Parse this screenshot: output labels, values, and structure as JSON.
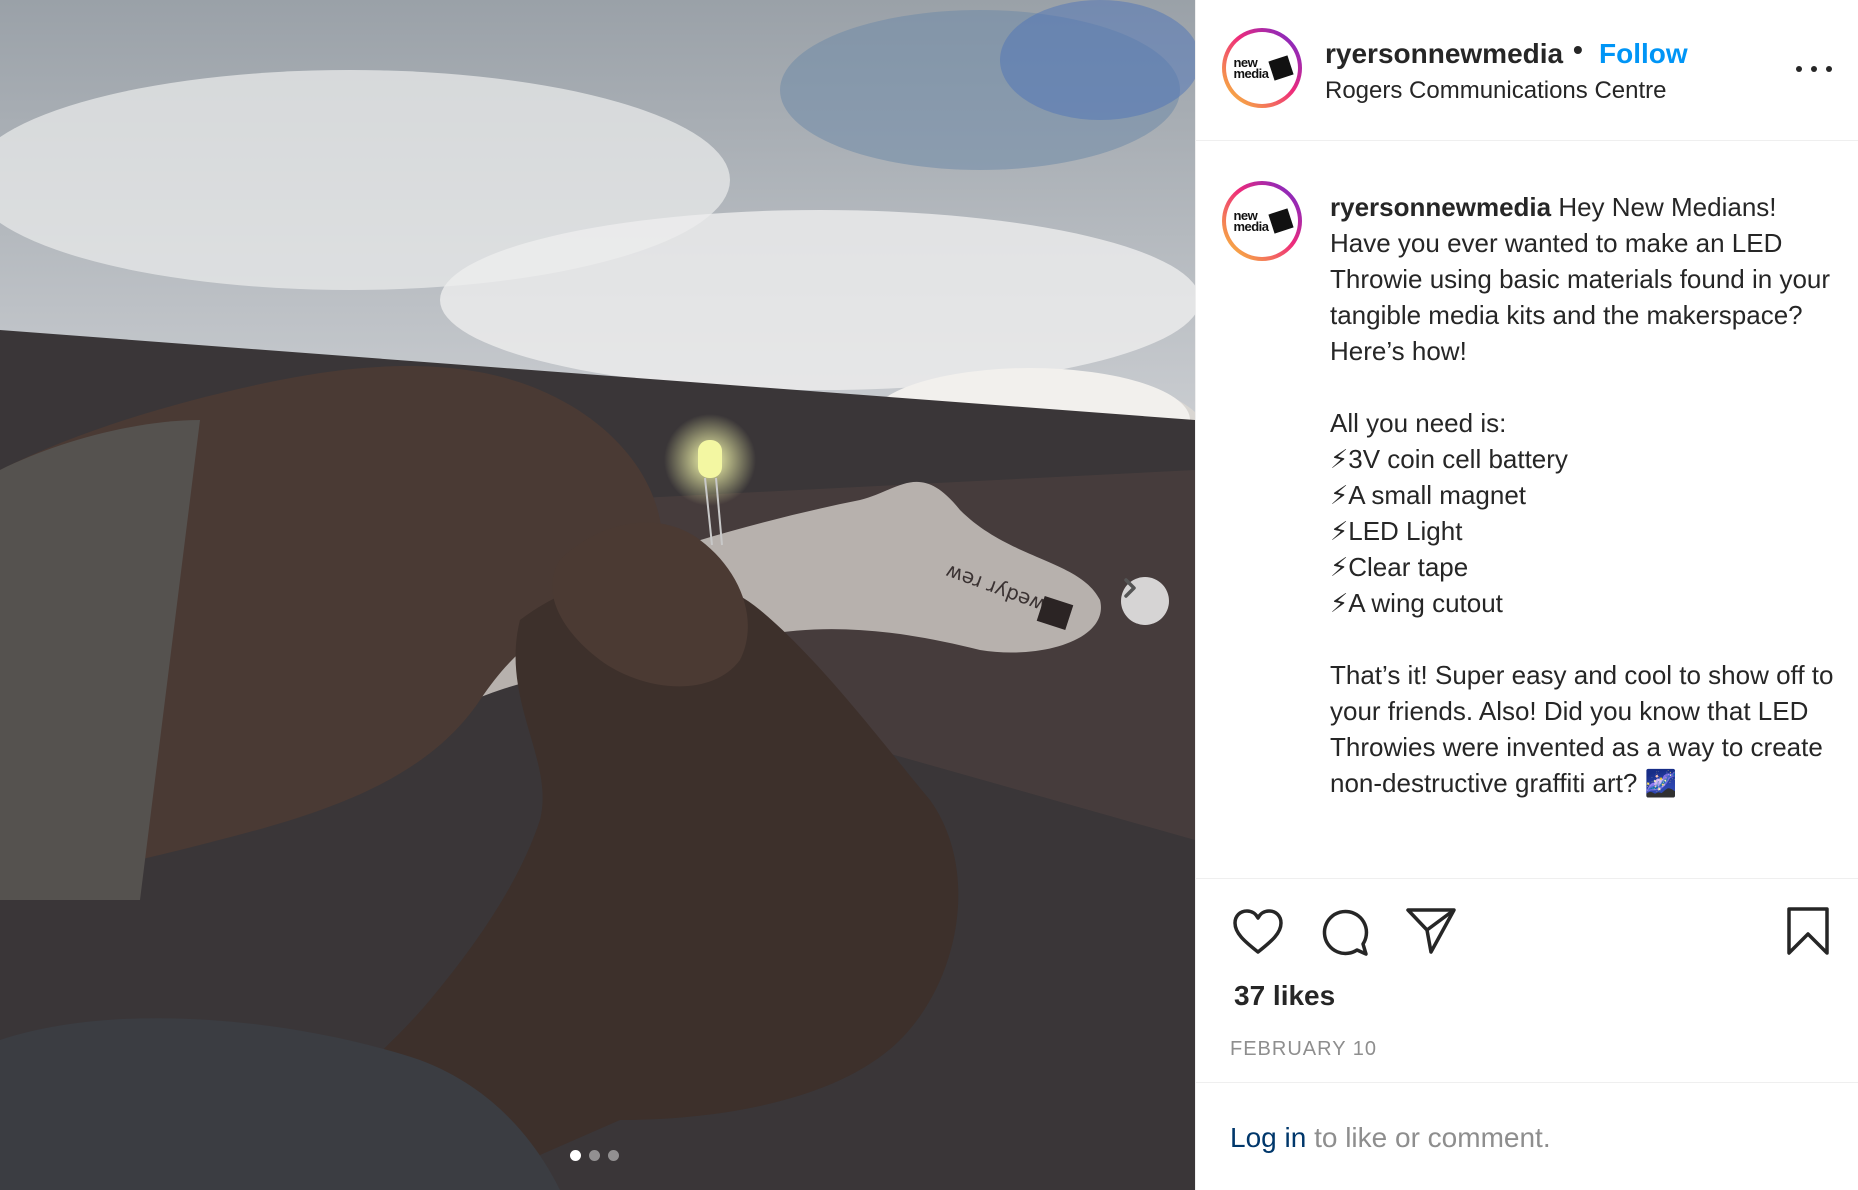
{
  "post": {
    "username": "ryersonnewmedia",
    "separator": "•",
    "follow_label": "Follow",
    "location": "Rogers Communications Centre",
    "avatar_logo_line1": "new",
    "avatar_logo_line2": "media",
    "caption_username": "ryersonnewmedia",
    "caption_text": " Hey New Medians! Have you ever wanted to make an LED Throwie using basic materials found in your tangible media kits and the makerspace? Here’s how!\n\nAll you need is:\n⚡3V coin cell battery\n⚡A small magnet\n⚡LED Light\n⚡Clear tape\n⚡A wing cutout\n\nThat’s it! Super easy and cool to show off to your friends. Also! Did you know that LED Throwies were invented as a way to create non-destructive graffiti art? 🌌",
    "likes": "37 likes",
    "date": "FEBRUARY 10",
    "login_link": "Log in",
    "login_rest": " to like or comment."
  },
  "carousel": {
    "current": 1,
    "total": 3
  },
  "icons": {
    "like": "heart-icon",
    "comment": "comment-icon",
    "share": "paper-plane-icon",
    "save": "bookmark-icon",
    "more": "ellipsis-icon",
    "next": "chevron-right-icon"
  },
  "colors": {
    "link_blue": "#0095f6",
    "text": "#262626",
    "muted": "#8e8e8e",
    "login_link": "#00376b"
  }
}
